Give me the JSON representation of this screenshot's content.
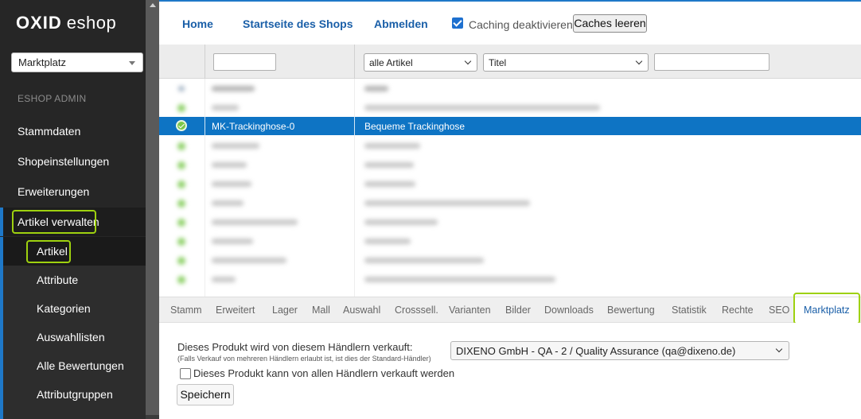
{
  "sidebar": {
    "logo_bold": "OXID",
    "logo_light": "eshop",
    "shop_select": "Marktplatz",
    "admin_label": "ESHOP ADMIN",
    "items": [
      {
        "label": "Stammdaten"
      },
      {
        "label": "Shopeinstellungen"
      },
      {
        "label": "Erweiterungen"
      },
      {
        "label": "Artikel verwalten"
      }
    ],
    "subitems": [
      {
        "label": "Artikel"
      },
      {
        "label": "Attribute"
      },
      {
        "label": "Kategorien"
      },
      {
        "label": "Auswahllisten"
      },
      {
        "label": "Alle Bewertungen"
      },
      {
        "label": "Attributgruppen"
      }
    ]
  },
  "topbar": {
    "home": "Home",
    "shop_start": "Startseite des Shops",
    "logout": "Abmelden",
    "caching_label": "Caching deaktivieren",
    "caching_checked": true,
    "clear_caches": "Caches leeren"
  },
  "filters": {
    "number_value": "",
    "type_select": "alle Artikel",
    "field_select": "Titel",
    "search_value": ""
  },
  "list": {
    "selected_row": {
      "number": "MK-Trackinghose-0",
      "title": "Bequeme Trackinghose"
    }
  },
  "tabs": [
    {
      "label": "Stamm"
    },
    {
      "label": "Erweitert"
    },
    {
      "label": "Lager"
    },
    {
      "label": "Mall"
    },
    {
      "label": "Auswahl"
    },
    {
      "label": "Crosssell."
    },
    {
      "label": "Varianten"
    },
    {
      "label": "Bilder"
    },
    {
      "label": "Downloads"
    },
    {
      "label": "Bewertung"
    },
    {
      "label": "Statistik"
    },
    {
      "label": "Rechte"
    },
    {
      "label": "SEO"
    },
    {
      "label": "Marktplatz"
    }
  ],
  "form": {
    "label": "Dieses Produkt wird von diesem Händlern verkauft:",
    "hint": "(Falls Verkauf von mehreren Händlern erlaubt ist, ist dies der Standard-Händler)",
    "merchant": "DIXENO GmbH - QA - 2 / Quality Assurance (qa@dixeno.de)",
    "all_merchants_label": "Dieses Produkt kann von allen Händlern verkauft werden",
    "all_merchants_checked": false,
    "save": "Speichern"
  },
  "colors": {
    "accent": "#1e78c8",
    "selected_row": "#0e74c4",
    "highlight": "#9ed10f",
    "sidebar_bg": "#262626"
  }
}
